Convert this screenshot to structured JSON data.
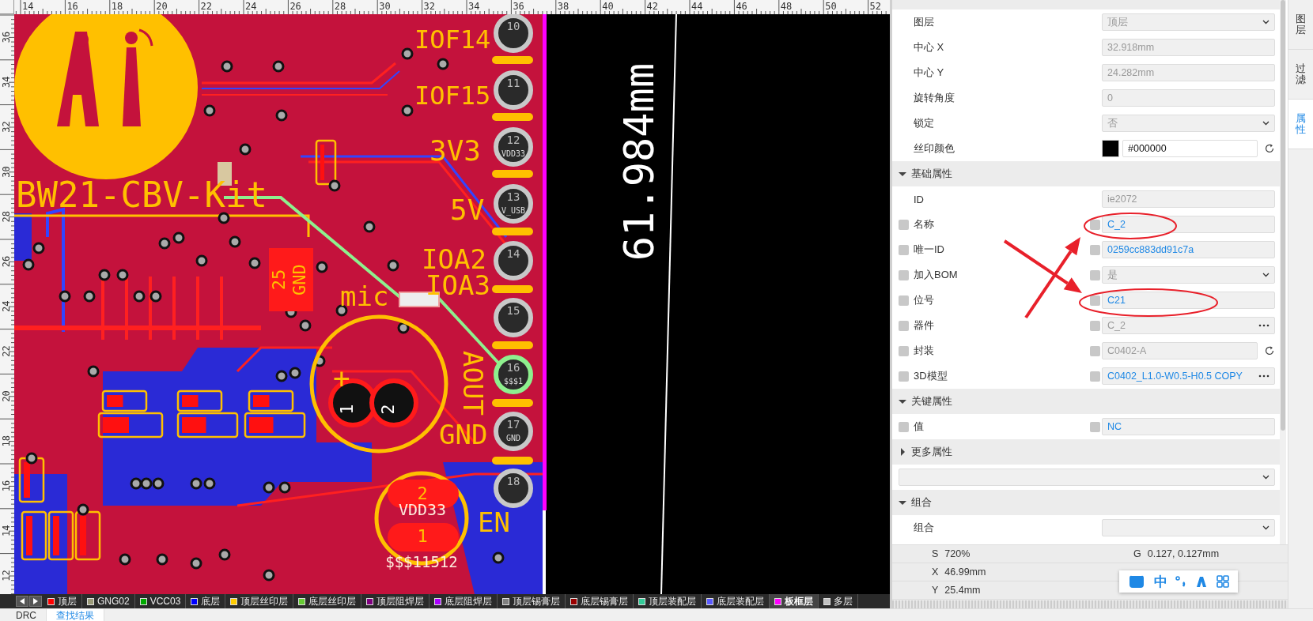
{
  "ruler": {
    "x_labels": [
      "14",
      "16",
      "18",
      "20",
      "22",
      "24",
      "26",
      "28",
      "30",
      "32",
      "34",
      "36",
      "38",
      "40",
      "42",
      "44",
      "46",
      "48",
      "50",
      "52"
    ],
    "y_labels": [
      "36",
      "34",
      "32",
      "30",
      "28",
      "26",
      "24",
      "22",
      "20",
      "18",
      "16",
      "14",
      "12"
    ]
  },
  "pcb": {
    "silkscreen": [
      {
        "text": "IOF14"
      },
      {
        "text": "IOF15"
      },
      {
        "text": "3V3"
      },
      {
        "text": "5V"
      },
      {
        "text": "IOA2"
      },
      {
        "text": "IOA3"
      },
      {
        "text": "mic"
      },
      {
        "text": "AOUT"
      },
      {
        "text": "GND"
      },
      {
        "text": "EN"
      },
      {
        "text": "BW21-CBV-Kit"
      },
      {
        "text": "25"
      },
      {
        "text": "GND"
      },
      {
        "text": "+"
      },
      {
        "text": "1"
      },
      {
        "text": "2"
      },
      {
        "text": "2"
      },
      {
        "text": "VDD33"
      },
      {
        "text": "1"
      },
      {
        "text": "$$$11512"
      }
    ],
    "pins": [
      {
        "number": "10",
        "highlighted": false
      },
      {
        "number": "11",
        "highlighted": false
      },
      {
        "number": "12",
        "net": "VDD33",
        "highlighted": false
      },
      {
        "number": "13",
        "net": "V_USB",
        "highlighted": false
      },
      {
        "number": "14",
        "highlighted": false
      },
      {
        "number": "15",
        "highlighted": false
      },
      {
        "number": "16",
        "net": "$$$1",
        "highlighted": true
      },
      {
        "number": "17",
        "net": "GND",
        "highlighted": false
      },
      {
        "number": "18",
        "highlighted": false
      }
    ],
    "dimension": "61.984mm"
  },
  "layer_tabs": [
    {
      "label": "顶层",
      "color": "#ff0000",
      "selected": false
    },
    {
      "label": "GNG02",
      "color": "#999977",
      "selected": false
    },
    {
      "label": "VCC03",
      "color": "#00aa00",
      "selected": false
    },
    {
      "label": "底层",
      "color": "#0000ff",
      "selected": false
    },
    {
      "label": "顶层丝印层",
      "color": "#ffcc00",
      "selected": false
    },
    {
      "label": "底层丝印层",
      "color": "#66cc33",
      "selected": false
    },
    {
      "label": "顶层阻焊层",
      "color": "#800080",
      "selected": false
    },
    {
      "label": "底层阻焊层",
      "color": "#aa00ff",
      "selected": false
    },
    {
      "label": "顶层锡膏层",
      "color": "#808080",
      "selected": false
    },
    {
      "label": "底层锡膏层",
      "color": "#990000",
      "selected": false
    },
    {
      "label": "顶层装配层",
      "color": "#33cc99",
      "selected": false
    },
    {
      "label": "底层装配层",
      "color": "#5a5aff",
      "selected": false
    },
    {
      "label": "板框层",
      "color": "#ff00ff",
      "selected": true
    },
    {
      "label": "多层",
      "color": "#c0c0c0",
      "selected": false
    }
  ],
  "properties": {
    "sections": [
      {
        "rows": [
          {
            "label": "图层",
            "kind": "select",
            "value": "顶层",
            "disabled": true
          },
          {
            "label": "中心 X",
            "kind": "text",
            "value": "32.918mm",
            "disabled": true
          },
          {
            "label": "中心 Y",
            "kind": "text",
            "value": "24.282mm",
            "disabled": true
          },
          {
            "label": "旋转角度",
            "kind": "text",
            "value": "0",
            "disabled": true
          },
          {
            "label": "锁定",
            "kind": "select",
            "value": "否",
            "disabled": true
          },
          {
            "label": "丝印颜色",
            "kind": "color",
            "value": "#000000"
          }
        ]
      },
      {
        "title": "基础属性",
        "expanded": true,
        "rows": [
          {
            "label": "ID",
            "kind": "text",
            "value": "ie2072",
            "disabled": true
          },
          {
            "label": "名称",
            "kind": "text",
            "value": "C_2",
            "disabled": false,
            "checked": false,
            "field_checked": false
          },
          {
            "label": "唯一ID",
            "kind": "text",
            "value": "0259cc883dd91c7a",
            "disabled": false,
            "checked": false,
            "field_checked": false
          },
          {
            "label": "加入BOM",
            "kind": "select",
            "value": "是",
            "disabled": true,
            "checked": false,
            "field_checked": false
          },
          {
            "label": "位号",
            "kind": "text",
            "value": "C21",
            "disabled": false,
            "checked": false,
            "field_checked": false
          },
          {
            "label": "器件",
            "kind": "more",
            "value": "C_2",
            "disabled": true,
            "checked": false,
            "field_checked": false
          },
          {
            "label": "封装",
            "kind": "reset",
            "value": "C0402-A",
            "disabled": true,
            "checked": false,
            "field_checked": false
          },
          {
            "label": "3D模型",
            "kind": "more",
            "value": "C0402_L1.0-W0.5-H0.5 COPY",
            "disabled": false,
            "checked": false,
            "field_checked": false
          }
        ]
      },
      {
        "title": "关键属性",
        "expanded": true,
        "rows": [
          {
            "label": "值",
            "kind": "text",
            "value": "NC",
            "disabled": false,
            "checked": false,
            "field_checked": false
          }
        ]
      },
      {
        "title": "更多属性",
        "expanded": false,
        "kind": "picker"
      },
      {
        "title": "组合",
        "expanded": true,
        "rows": [
          {
            "label": "组合",
            "kind": "select"
          }
        ]
      }
    ]
  },
  "status": [
    [
      {
        "key": "S",
        "value": "720%"
      },
      {
        "key": "G",
        "value": "0.127, 0.127mm"
      }
    ],
    [
      {
        "key": "X",
        "value": "46.99mm"
      }
    ],
    [
      {
        "key": "Y",
        "value": "25.4mm"
      }
    ]
  ],
  "ime_toolbar": {
    "mode": "中"
  },
  "side_tabs": [
    {
      "label": "图层",
      "selected": false
    },
    {
      "label": "过滤",
      "selected": false
    },
    {
      "label": "属性",
      "selected": true
    }
  ],
  "bottom_tabs": [
    {
      "label": "DRC",
      "selected": false
    },
    {
      "label": "查找结果",
      "selected": true
    }
  ]
}
